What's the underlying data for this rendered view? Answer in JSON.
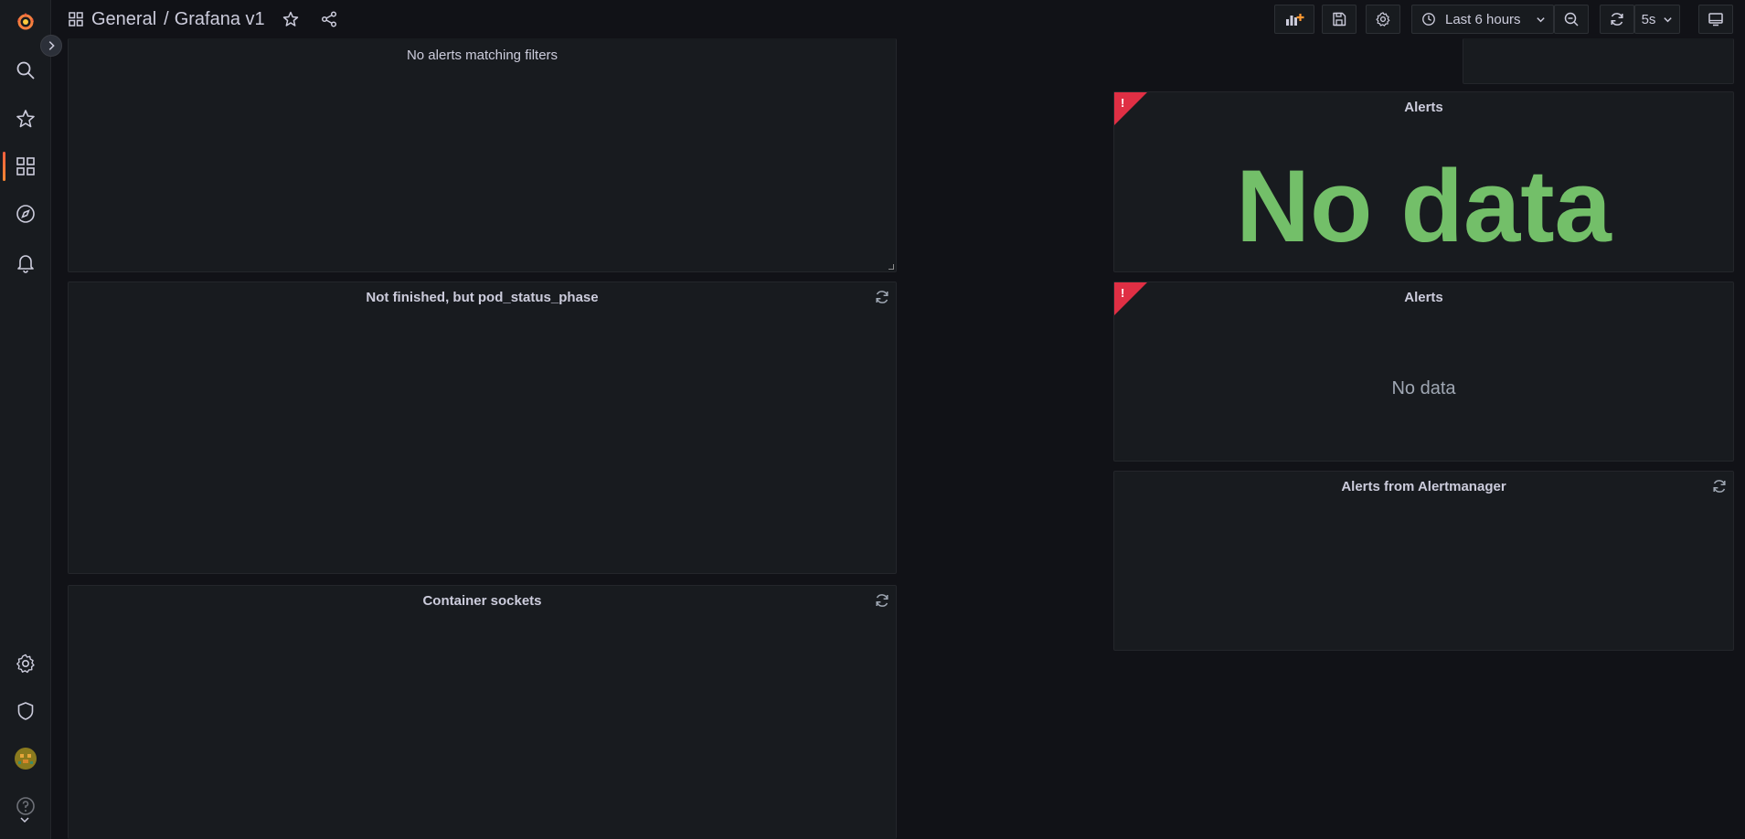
{
  "topbar": {
    "breadcrumb_folder": "General",
    "breadcrumb_separator": "/",
    "breadcrumb_dashboard": "Grafana v1",
    "time_range": "Last 6 hours",
    "refresh_interval": "5s"
  },
  "panels": {
    "alert_list": {
      "message": "No alerts matching filters"
    },
    "pod_status": {
      "title": "Not finished, but pod_status_phase"
    },
    "container_sockets": {
      "title": "Container sockets"
    },
    "alerts_stat": {
      "title": "Alerts",
      "value": "No data",
      "badge": "!"
    },
    "alerts_graph": {
      "title": "Alerts",
      "value": "No data",
      "badge": "!"
    },
    "alertmanager": {
      "title": "Alerts from Alertmanager"
    }
  },
  "colors": {
    "background": "#111217",
    "panel": "#181b1f",
    "stat_green": "#73bf69",
    "alert_red": "#e02f44",
    "brand_orange": "#f55f3e"
  }
}
